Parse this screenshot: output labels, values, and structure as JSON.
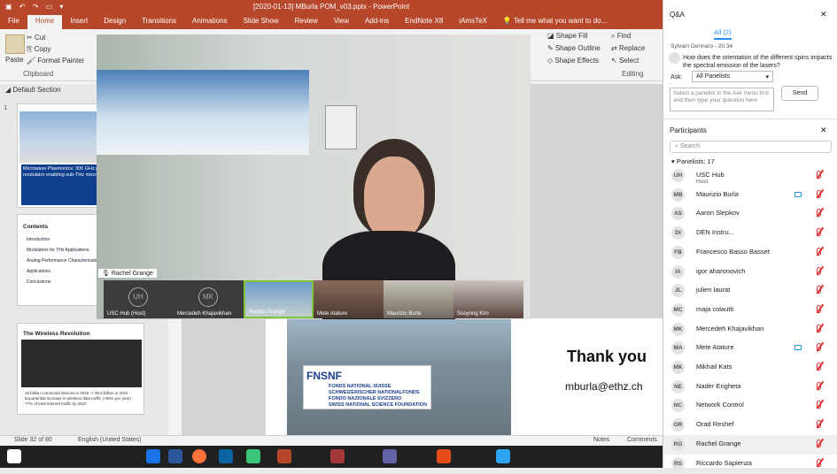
{
  "pp": {
    "title": "[2020-01-13] MBurla POM_v03.pptx  -  PowerPoint",
    "quick_access": "▣ ↶ ↷ ▭ ▾",
    "tabs": [
      "File",
      "Home",
      "Insert",
      "Design",
      "Transitions",
      "Animations",
      "Slide Show",
      "Review",
      "View",
      "Add-ins",
      "EndNote X8",
      "iAmsTeX"
    ],
    "tell_me": "Tell me what you want to do...",
    "ribbon": {
      "cut": "Cut",
      "copy": "Copy",
      "paste": "Paste",
      "format_painter": "Format Painter",
      "clipboard": "Clipboard",
      "shape_fill": "Shape Fill",
      "shape_outline": "Shape Outline",
      "shape_effects": "Shape Effects",
      "find": "Find",
      "replace": "Replace",
      "select": "Select",
      "editing": "Editing"
    },
    "section": "Default Section",
    "thumbs": [
      {
        "num": "1",
        "title": "Microwave Plasmonics: 300 GHz plasmonic modulator enabling sub-THz microwave photonics"
      },
      {
        "num": "",
        "title": "Contents",
        "items": [
          "Introduction",
          "Modulators for THz Applications",
          "Analog Performance Characterization",
          "Applications",
          "Conclusions"
        ]
      },
      {
        "num": "",
        "title": "The Wireless Revolution",
        "bullets": [
          "16 billion connected devices in 2016 -> 28.5 billion in 2022",
          "Exponential increase in wireless data traffic (>50% per year)",
          "77% of total internet traffic by 2022"
        ]
      }
    ],
    "status": {
      "slide": "Slide 32 of 80",
      "lang": "English (United States)",
      "notes": "Notes",
      "comments": "Comments"
    },
    "slide": {
      "thank_you": "Thank you",
      "email": "mburla@ethz.ch",
      "fnsnf": "FNSNF",
      "fn_lines": [
        "FONDS NATIONAL SUISSE",
        "SCHWEIZERISCHER NATIONALFONDS",
        "FONDO NAZIONALE SVIZZERO",
        "SWISS NATIONAL SCIENCE FOUNDATION"
      ]
    }
  },
  "meeting": {
    "speaker": "Rachel Grange",
    "strip": [
      {
        "initials": "UH",
        "name": "USC Hub (Host)"
      },
      {
        "initials": "MK",
        "name": "Mercedeh Khajavikhan"
      },
      {
        "initials": "",
        "name": "Rachel Grange"
      },
      {
        "initials": "",
        "name": "Mete Atature"
      },
      {
        "initials": "",
        "name": "Maurizio Burla"
      },
      {
        "initials": "",
        "name": "Sooyong Kim"
      }
    ]
  },
  "qa": {
    "title": "Q&A",
    "tab": "All (2)",
    "asker": "Sylvain Gennaro - 20:34",
    "question": "How does the orientation of the different spins impacts the spectral emission of the lasers?",
    "ask_label": "Ask:",
    "ask_value": "All Panelists",
    "placeholder": "Select a panelist in the Ask menu first and then type your question here.",
    "send": "Send"
  },
  "participants": {
    "title": "Participants",
    "search": "Search",
    "group": "Panelists: 17",
    "list": [
      {
        "initials": "UH",
        "name": "USC Hub",
        "sub": "Host"
      },
      {
        "initials": "MB",
        "name": "Maurizio Burla",
        "sub": "",
        "cam": true
      },
      {
        "initials": "AS",
        "name": "Aaron Slepkov",
        "sub": ""
      },
      {
        "initials": "DI",
        "name": "DEN Instru...",
        "sub": ""
      },
      {
        "initials": "FB",
        "name": "Francesco Basso Basset",
        "sub": ""
      },
      {
        "initials": "IA",
        "name": "igor aharonovich",
        "sub": ""
      },
      {
        "initials": "JL",
        "name": "julien laurat",
        "sub": ""
      },
      {
        "initials": "MC",
        "name": "maja colautti",
        "sub": ""
      },
      {
        "initials": "MK",
        "name": "Mercedeh Khajavikhan",
        "sub": ""
      },
      {
        "initials": "MA",
        "name": "Mete Atature",
        "sub": "",
        "cam": true
      },
      {
        "initials": "MK",
        "name": "Mikhail Kats",
        "sub": ""
      },
      {
        "initials": "NE",
        "name": "Nader Engheta",
        "sub": ""
      },
      {
        "initials": "NC",
        "name": "Network Control",
        "sub": ""
      },
      {
        "initials": "OR",
        "name": "Orad Reshef",
        "sub": ""
      },
      {
        "initials": "RG",
        "name": "Rachel Grange",
        "sub": "",
        "active": true
      },
      {
        "initials": "RS",
        "name": "Riccardo Sapienza",
        "sub": ""
      }
    ]
  },
  "colors": {
    "pp_red": "#b7472a",
    "zoom_blue": "#2d8cff",
    "mute_red": "#d33"
  }
}
